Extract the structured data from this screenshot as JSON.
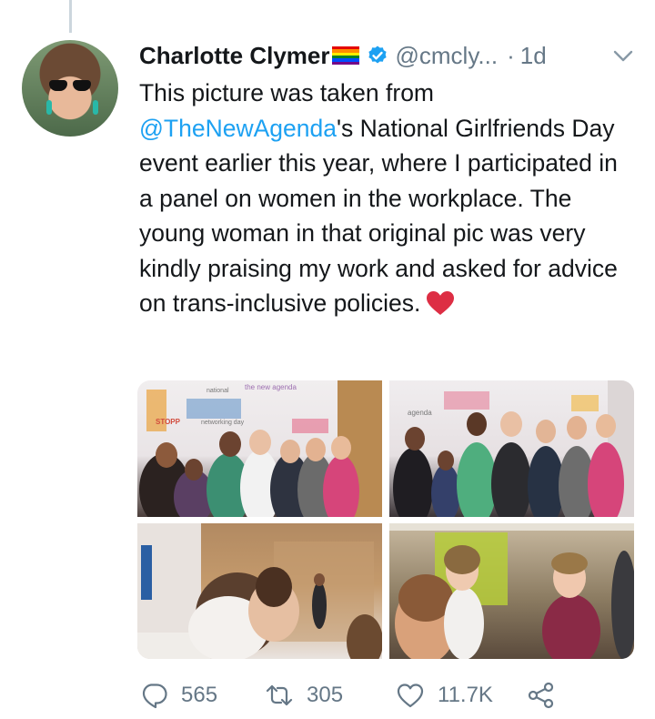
{
  "tweet": {
    "author_name": "Charlotte Clymer",
    "author_handle": "@cmcly...",
    "separator": "·",
    "timestamp": "1d",
    "text_segments": {
      "p1": "This picture was taken from ",
      "mention": "@TheNewAgenda",
      "p2": "'s National Girlfriends Day event earlier this year, where I participated in a panel on women in the workplace. The young woman in that original pic was very kindly praising my work and asked for advice on trans-inclusive policies."
    }
  },
  "photo_signs": {
    "p1": {
      "top": "the new agenda",
      "national": "national",
      "networking": "networking day",
      "stopp": "STOPP"
    },
    "p2": {
      "agenda": "agenda"
    }
  },
  "icons": {
    "avatar": "profile-photo",
    "flag": "rainbow-flag-emoji",
    "verified": "verified-badge-icon",
    "caret": "chevron-down-icon",
    "heart_emoji": "red-heart-emoji",
    "reply": "reply-icon",
    "retweet": "retweet-icon",
    "like": "heart-outline-icon",
    "share": "share-icon"
  },
  "actions": {
    "reply_count": "565",
    "retweet_count": "305",
    "like_count": "11.7K"
  },
  "colors": {
    "text": "#14171a",
    "secondary": "#657786",
    "link": "#1da1f2",
    "verified": "#1da1f2",
    "heart": "#dd2e44",
    "thread_line": "#ccd6dd"
  }
}
